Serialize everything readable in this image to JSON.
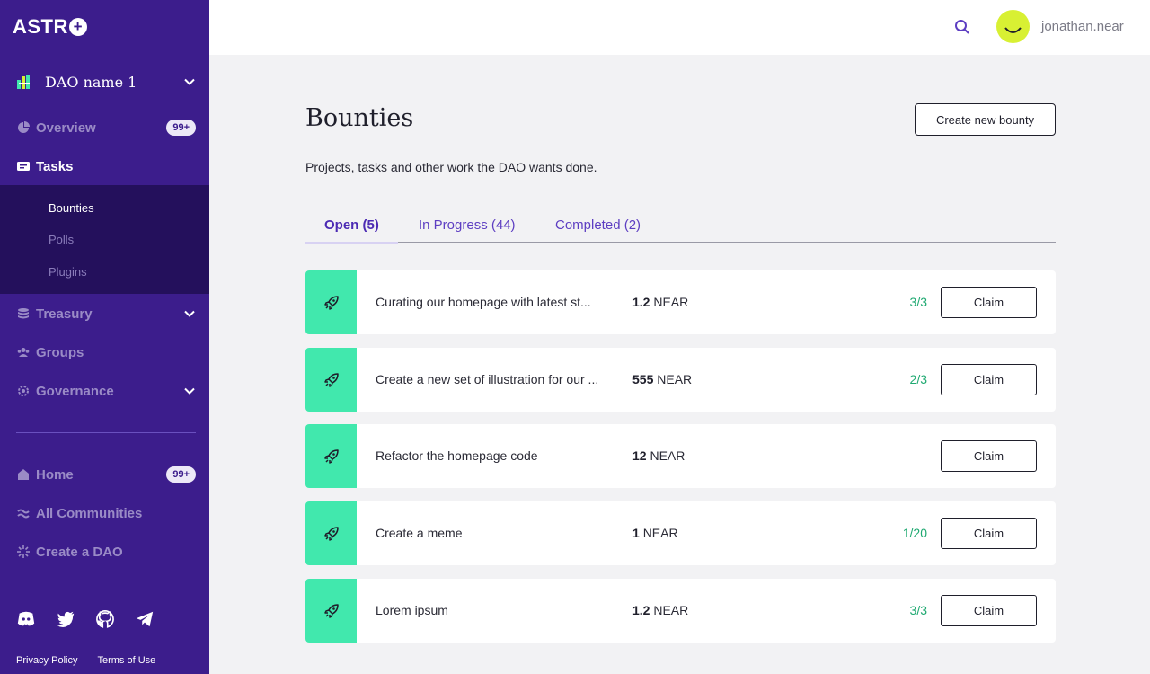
{
  "sidebar": {
    "logo": "ASTR",
    "logo_suffix": "+",
    "dao_name": "DAO name 1",
    "nav": {
      "overview": {
        "label": "Overview",
        "badge": "99+"
      },
      "tasks": {
        "label": "Tasks"
      },
      "treasury": {
        "label": "Treasury"
      },
      "groups": {
        "label": "Groups"
      },
      "governance": {
        "label": "Governance"
      },
      "home": {
        "label": "Home",
        "badge": "99+"
      },
      "all_communities": {
        "label": "All Communities"
      },
      "create_dao": {
        "label": "Create a DAO"
      }
    },
    "submenu": [
      "Bounties",
      "Polls",
      "Plugins"
    ],
    "footer": {
      "privacy": "Privacy Policy",
      "terms": "Terms of Use"
    }
  },
  "topbar": {
    "username": "jonathan.near"
  },
  "main": {
    "title": "Bounties",
    "create_button": "Create new bounty",
    "description": "Projects, tasks and other work the DAO wants done.",
    "tabs": [
      "Open (5)",
      "In Progress (44)",
      "Completed (2)"
    ],
    "claim_label": "Claim",
    "currency": "NEAR",
    "bounties": [
      {
        "title": "Curating our homepage with latest st...",
        "amount": "1.2",
        "count": "3/3"
      },
      {
        "title": "Create a new set of illustration for our ...",
        "amount": "555",
        "count": "2/3"
      },
      {
        "title": "Refactor the homepage code",
        "amount": "12",
        "count": ""
      },
      {
        "title": "Create a meme",
        "amount": "1",
        "count": "1/20"
      },
      {
        "title": "Lorem ipsum",
        "amount": "1.2",
        "count": "3/3"
      }
    ]
  },
  "colors": {
    "sidebar_bg": "#3c1d8c",
    "submenu_bg": "#24105c",
    "accent": "#5d3ec2",
    "bounty_icon_bg": "#41e8ad",
    "count_green": "#1fa971",
    "avatar": "#d8f033"
  },
  "icons": [
    "overview-icon",
    "tasks-icon",
    "treasury-icon",
    "groups-icon",
    "governance-icon",
    "home-icon",
    "communities-icon",
    "create-dao-icon",
    "discord-icon",
    "twitter-icon",
    "github-icon",
    "telegram-icon",
    "search-icon",
    "rocket-icon",
    "chevron-down-icon"
  ]
}
